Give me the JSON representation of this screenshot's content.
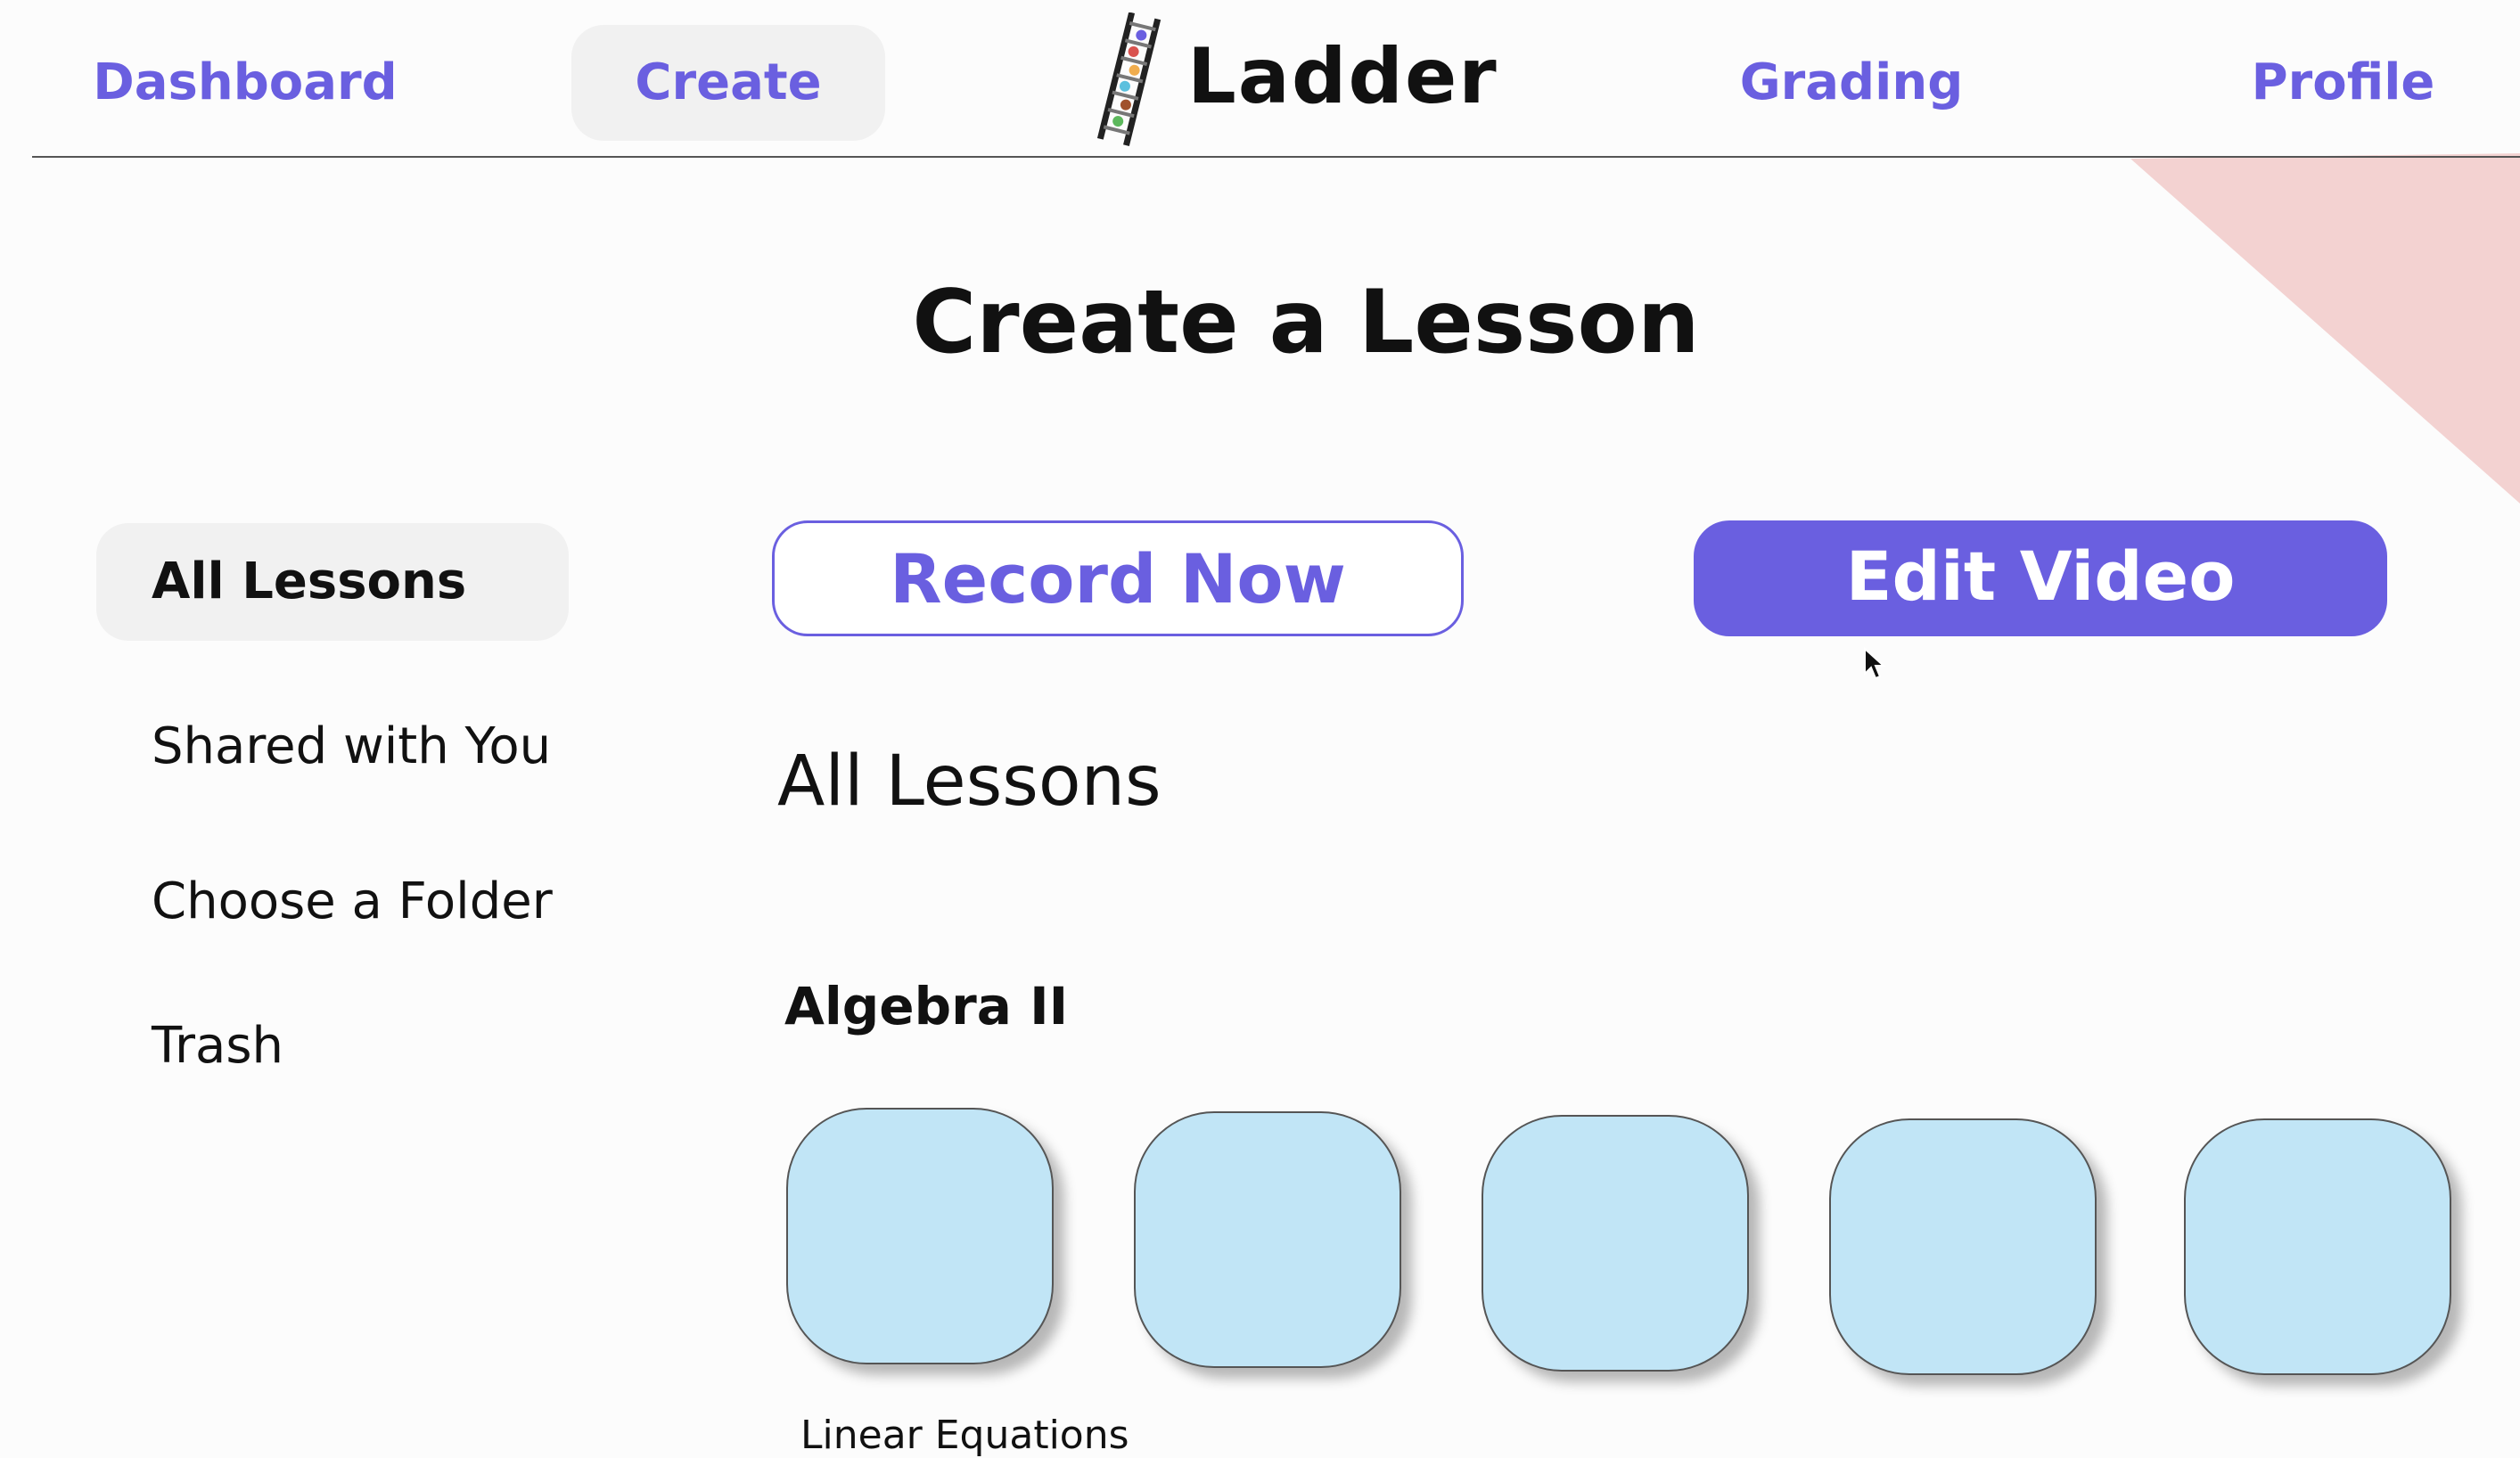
{
  "nav": {
    "dashboard": "Dashboard",
    "create": "Create",
    "grading": "Grading",
    "profile": "Profile",
    "brand": "Ladder"
  },
  "page_title": "Create a Lesson",
  "sidebar": {
    "items": [
      {
        "label": "All Lessons",
        "active": true
      },
      {
        "label": "Shared with You"
      },
      {
        "label": "Choose a Folder"
      },
      {
        "label": "Trash"
      }
    ]
  },
  "actions": {
    "record": "Record Now",
    "edit": "Edit Video"
  },
  "section_title": "All Lessons",
  "folder": {
    "title": "Algebra II",
    "first_lesson_label": "Linear Equations",
    "lessons_visible": 5
  },
  "colors": {
    "accent": "#6a5fe0",
    "tile": "#c1e5f6",
    "decor": "#f3d2d1",
    "pill": "#f1f1f1"
  }
}
